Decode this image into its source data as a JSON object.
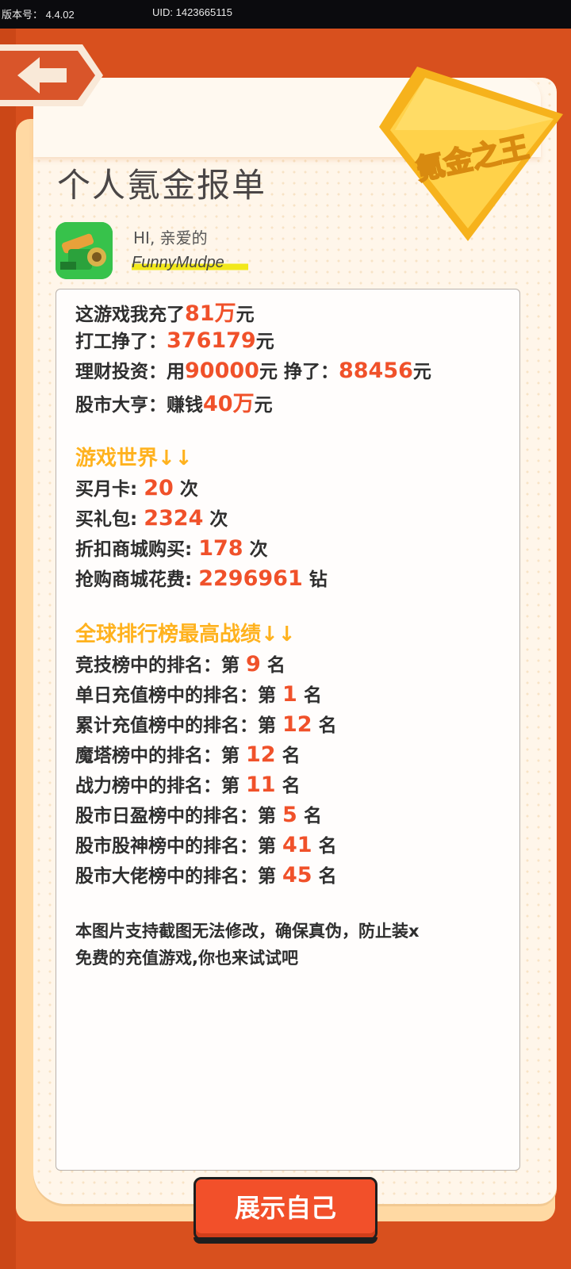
{
  "status_bar": {
    "version": "版本号： 4.4.02",
    "uid": "UID: 1423665115"
  },
  "badge": {
    "text": "氪金之王"
  },
  "page_title": "个人氪金报单",
  "profile": {
    "greeting": "HI, 亲爱的",
    "username": "FunnyMudpe"
  },
  "summary": {
    "total_prefix": "这游戏我充了",
    "total_value": "81万",
    "total_unit": "元",
    "work_prefix": "打工挣了：",
    "work_value": "376179",
    "work_unit": "元",
    "invest_prefix": "理财投资：用",
    "invest_value": "90000",
    "invest_mid": "元 挣了：",
    "invest_earn": "88456",
    "invest_unit": "元",
    "stock_prefix": "股市大亨：赚钱",
    "stock_value": "40万",
    "stock_unit": "元"
  },
  "game_world": {
    "heading": "游戏世界↓↓",
    "items": [
      {
        "label": "买月卡:",
        "value": "20",
        "unit": "次"
      },
      {
        "label": "买礼包:",
        "value": "2324",
        "unit": "次"
      },
      {
        "label": "折扣商城购买:",
        "value": "178",
        "unit": "次"
      },
      {
        "label": "抢购商城花费:",
        "value": "2296961",
        "unit": "钻"
      }
    ]
  },
  "rankings": {
    "heading": "全球排行榜最高战绩↓↓",
    "prefix": "第",
    "suffix": "名",
    "items": [
      {
        "label": "竞技榜中的排名：",
        "value": "9"
      },
      {
        "label": "单日充值榜中的排名：",
        "value": "1"
      },
      {
        "label": "累计充值榜中的排名：",
        "value": "12"
      },
      {
        "label": "魔塔榜中的排名：",
        "value": "12"
      },
      {
        "label": "战力榜中的排名：",
        "value": "11"
      },
      {
        "label": "股市日盈榜中的排名：",
        "value": "5"
      },
      {
        "label": "股市股神榜中的排名：",
        "value": "41"
      },
      {
        "label": "股市大佬榜中的排名：",
        "value": "45"
      }
    ]
  },
  "note": {
    "line1": "本图片支持截图无法修改，确保真伪，防止装x",
    "line2": "免费的充值游戏,你也来试试吧"
  },
  "show_button": {
    "label": "展示自己"
  },
  "colors": {
    "background": "#D8501E",
    "highlight_number": "#F0512A",
    "section_heading": "#FFB21E",
    "button": "#F2502A"
  },
  "icons": {
    "back": "arrow-left-icon",
    "avatar": "cannon-avatar-icon"
  }
}
